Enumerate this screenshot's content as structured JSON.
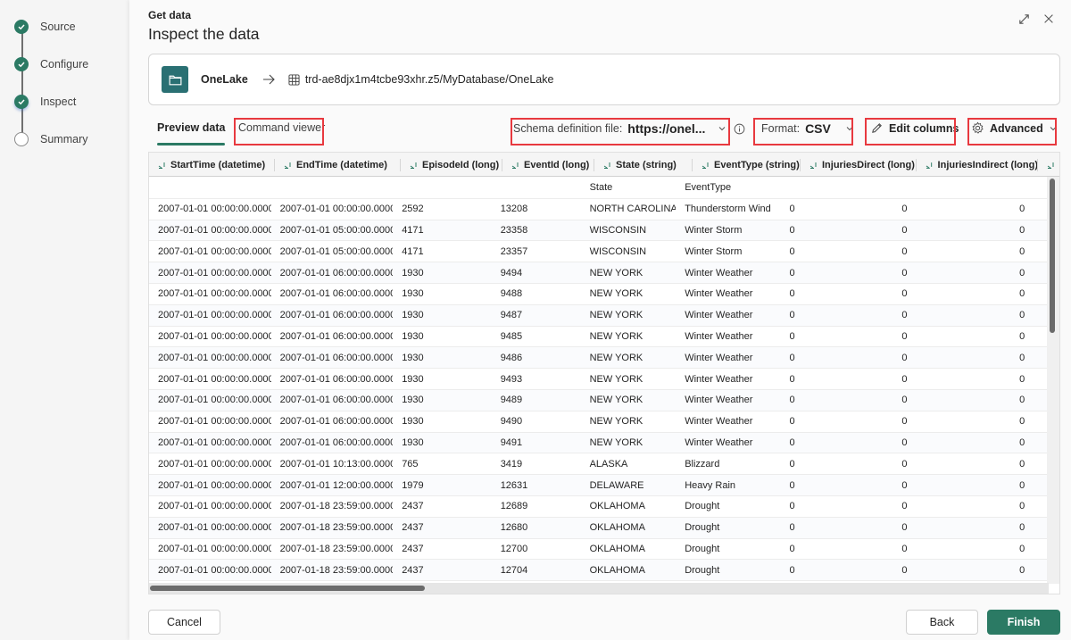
{
  "stepper": {
    "steps": [
      {
        "label": "Source",
        "state": "done"
      },
      {
        "label": "Configure",
        "state": "done"
      },
      {
        "label": "Inspect",
        "state": "current"
      },
      {
        "label": "Summary",
        "state": "pending"
      }
    ]
  },
  "header": {
    "breadcrumb": "Get data",
    "title": "Inspect the data",
    "expand_icon": "expand-icon",
    "close_icon": "close-icon"
  },
  "source": {
    "icon": "folder-icon",
    "name": "OneLake",
    "arrow_icon": "arrow-right-icon",
    "table_icon": "table-icon",
    "path": "trd-ae8djx1m4tcbe93xhr.z5/MyDatabase/OneLake"
  },
  "tabs": [
    {
      "label": "Preview data",
      "active": true
    },
    {
      "label": "Command viewer",
      "active": false
    }
  ],
  "toolbar": {
    "schema_label": "Schema definition file:",
    "schema_value": "https://onel...",
    "format_label": "Format:",
    "format_value": "CSV",
    "edit_columns_label": "Edit columns",
    "advanced_label": "Advanced"
  },
  "accent_color": "#2b7a64",
  "highlight_color": "#e8393f",
  "table": {
    "columns": [
      "StartTime (datetime)",
      "EndTime (datetime)",
      "EpisodeId (long)",
      "EventId (long)",
      "State (string)",
      "EventType (string)",
      "InjuriesDirect (long)",
      "InjuriesIndirect (long)",
      ""
    ],
    "mapping_row": [
      "",
      "",
      "",
      "",
      "State",
      "EventType",
      "",
      "",
      ""
    ],
    "rows": [
      [
        "2007-01-01 00:00:00.0000",
        "2007-01-01 00:00:00.0000",
        "2592",
        "13208",
        "NORTH CAROLINA",
        "Thunderstorm Wind",
        "0",
        "0",
        "0"
      ],
      [
        "2007-01-01 00:00:00.0000",
        "2007-01-01 05:00:00.0000",
        "4171",
        "23358",
        "WISCONSIN",
        "Winter Storm",
        "0",
        "0",
        "0"
      ],
      [
        "2007-01-01 00:00:00.0000",
        "2007-01-01 05:00:00.0000",
        "4171",
        "23357",
        "WISCONSIN",
        "Winter Storm",
        "0",
        "0",
        "0"
      ],
      [
        "2007-01-01 00:00:00.0000",
        "2007-01-01 06:00:00.0000",
        "1930",
        "9494",
        "NEW YORK",
        "Winter Weather",
        "0",
        "0",
        "0"
      ],
      [
        "2007-01-01 00:00:00.0000",
        "2007-01-01 06:00:00.0000",
        "1930",
        "9488",
        "NEW YORK",
        "Winter Weather",
        "0",
        "0",
        "0"
      ],
      [
        "2007-01-01 00:00:00.0000",
        "2007-01-01 06:00:00.0000",
        "1930",
        "9487",
        "NEW YORK",
        "Winter Weather",
        "0",
        "0",
        "0"
      ],
      [
        "2007-01-01 00:00:00.0000",
        "2007-01-01 06:00:00.0000",
        "1930",
        "9485",
        "NEW YORK",
        "Winter Weather",
        "0",
        "0",
        "0"
      ],
      [
        "2007-01-01 00:00:00.0000",
        "2007-01-01 06:00:00.0000",
        "1930",
        "9486",
        "NEW YORK",
        "Winter Weather",
        "0",
        "0",
        "0"
      ],
      [
        "2007-01-01 00:00:00.0000",
        "2007-01-01 06:00:00.0000",
        "1930",
        "9493",
        "NEW YORK",
        "Winter Weather",
        "0",
        "0",
        "0"
      ],
      [
        "2007-01-01 00:00:00.0000",
        "2007-01-01 06:00:00.0000",
        "1930",
        "9489",
        "NEW YORK",
        "Winter Weather",
        "0",
        "0",
        "0"
      ],
      [
        "2007-01-01 00:00:00.0000",
        "2007-01-01 06:00:00.0000",
        "1930",
        "9490",
        "NEW YORK",
        "Winter Weather",
        "0",
        "0",
        "0"
      ],
      [
        "2007-01-01 00:00:00.0000",
        "2007-01-01 06:00:00.0000",
        "1930",
        "9491",
        "NEW YORK",
        "Winter Weather",
        "0",
        "0",
        "0"
      ],
      [
        "2007-01-01 00:00:00.0000",
        "2007-01-01 10:13:00.0000",
        "765",
        "3419",
        "ALASKA",
        "Blizzard",
        "0",
        "0",
        "0"
      ],
      [
        "2007-01-01 00:00:00.0000",
        "2007-01-01 12:00:00.0000",
        "1979",
        "12631",
        "DELAWARE",
        "Heavy Rain",
        "0",
        "0",
        "0"
      ],
      [
        "2007-01-01 00:00:00.0000",
        "2007-01-18 23:59:00.0000",
        "2437",
        "12689",
        "OKLAHOMA",
        "Drought",
        "0",
        "0",
        "0"
      ],
      [
        "2007-01-01 00:00:00.0000",
        "2007-01-18 23:59:00.0000",
        "2437",
        "12680",
        "OKLAHOMA",
        "Drought",
        "0",
        "0",
        "0"
      ],
      [
        "2007-01-01 00:00:00.0000",
        "2007-01-18 23:59:00.0000",
        "2437",
        "12700",
        "OKLAHOMA",
        "Drought",
        "0",
        "0",
        "0"
      ],
      [
        "2007-01-01 00:00:00.0000",
        "2007-01-18 23:59:00.0000",
        "2437",
        "12704",
        "OKLAHOMA",
        "Drought",
        "0",
        "0",
        "0"
      ]
    ]
  },
  "footer": {
    "cancel_label": "Cancel",
    "back_label": "Back",
    "finish_label": "Finish"
  }
}
